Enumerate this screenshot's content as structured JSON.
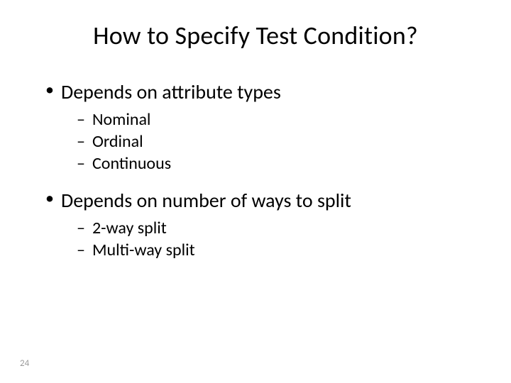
{
  "slide": {
    "title": "How to Specify Test Condition?",
    "bullets": [
      {
        "text": "Depends on attribute types",
        "sub": [
          "Nominal",
          "Ordinal",
          "Continuous"
        ]
      },
      {
        "text": "Depends on number of ways to split",
        "sub": [
          "2-way split",
          "Multi-way split"
        ]
      }
    ],
    "page_number": "24"
  }
}
